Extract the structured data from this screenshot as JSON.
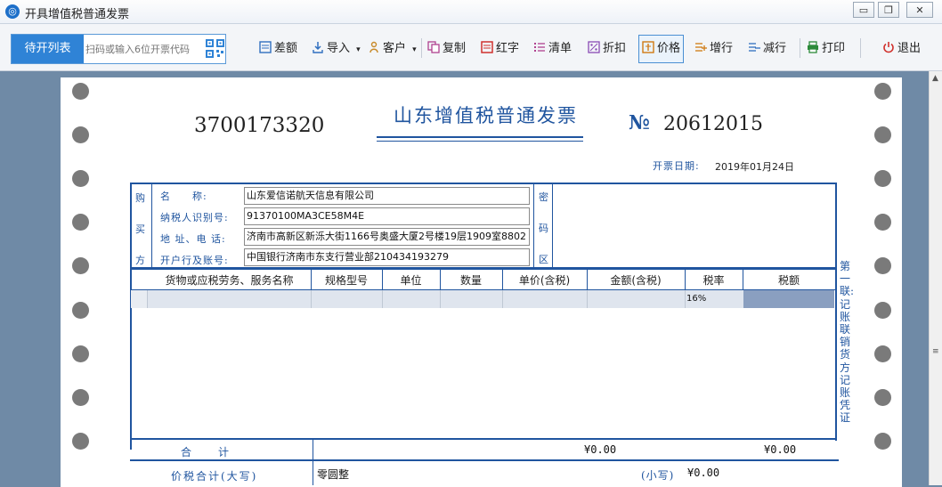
{
  "window": {
    "title": "开具增值税普通发票",
    "minimize": "▭",
    "restore": "❐",
    "close": "✕"
  },
  "toolbar": {
    "pending_label": "待开列表",
    "scan_placeholder": "扫码或输入6位开票代码",
    "buttons": {
      "diff": "差额",
      "import": "导入",
      "customer": "客户",
      "copy": "复制",
      "red": "红字",
      "list": "清单",
      "discount": "折扣",
      "price": "价格",
      "add_row": "增行",
      "del_row": "减行",
      "print": "打印",
      "exit": "退出"
    },
    "dropdown_glyph": "▾"
  },
  "invoice": {
    "code": "3700173320",
    "title": "山东增值税普通发票",
    "number_symbol": "№",
    "number": "20612015",
    "date_label": "开票日期:",
    "date": "2019年01月24日",
    "buyer": {
      "side_chars": [
        "购",
        "买",
        "方"
      ],
      "name_label": "名　　称:",
      "name": "山东爱信诺航天信息有限公司",
      "taxid_label": "纳税人识别号:",
      "taxid": "91370100MA3CE58M4E",
      "address_label": "地 址、电 话:",
      "address": "济南市高新区新泺大街1166号奥盛大厦2号楼19层1909室8802",
      "bank_label": "开户行及账号:",
      "bank": "中国银行济南市东支行营业部210434193279"
    },
    "cipher_chars": [
      "密",
      "码",
      "区"
    ],
    "columns": [
      "货物或应税劳务、服务名称",
      "规格型号",
      "单位",
      "数量",
      "单价(含税)",
      "金额(含税)",
      "税率",
      "税额"
    ],
    "rows": [
      {
        "name": "",
        "spec": "",
        "unit": "",
        "qty": "",
        "price": "",
        "amount": "",
        "rate": "16%",
        "tax": ""
      }
    ],
    "total_label": "合　　计",
    "total_amount": "¥0.00",
    "total_tax": "¥0.00",
    "grand_label": "价税合计(大写)",
    "grand_upper": "零圆整",
    "grand_small_label": "(小写)",
    "grand_small": "¥0.00",
    "side_note": "第一联:记账联 销货方记账凭证"
  },
  "colors": {
    "invoice_blue": "#20559f",
    "accent": "#2f83d6",
    "background": "#6f8aa6"
  }
}
